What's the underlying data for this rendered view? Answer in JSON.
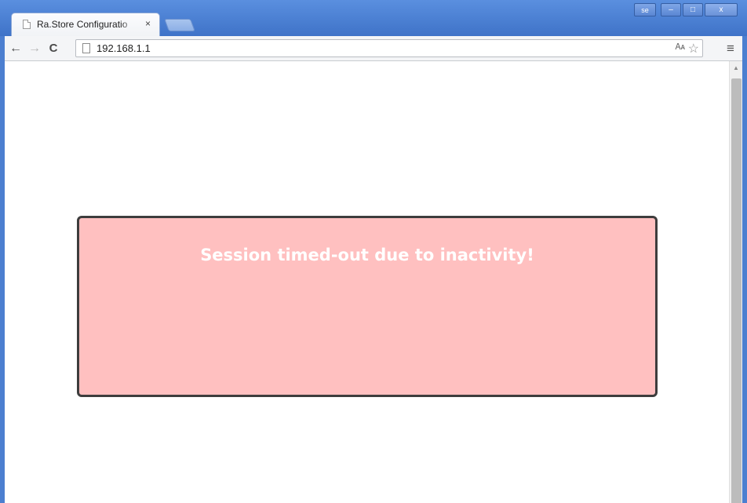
{
  "browser": {
    "tab": {
      "title": "Ra.Store Configuratio",
      "close_glyph": "×"
    },
    "caption": {
      "user_label": "se",
      "minimize_glyph": "–",
      "maximize_glyph": "□",
      "close_glyph": "x"
    },
    "nav": {
      "back_glyph": "←",
      "forward_glyph": "→",
      "reload_glyph": "C",
      "menu_glyph": "≡"
    },
    "address_bar": {
      "url": "192.168.1.1",
      "translate_icon": "translate-icon",
      "star_icon": "bookmark-star-icon",
      "translate_glyph": "🗛",
      "star_glyph": "☆"
    },
    "scrollbar": {
      "up_glyph": "▲"
    }
  },
  "page": {
    "alert": {
      "message": "Session timed-out due to inactivity!",
      "background_color": "#ffc0c0",
      "border_color": "#3d3d3d",
      "text_color": "#ffffff"
    }
  }
}
